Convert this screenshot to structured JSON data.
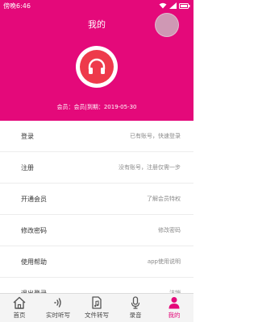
{
  "status_bar": {
    "time": "傍晚6:46"
  },
  "header": {
    "title": "我的",
    "member_info": "会员：会员|到期：2019-05-30"
  },
  "menu": [
    {
      "label": "登录",
      "hint": "已有账号，快速登录"
    },
    {
      "label": "注册",
      "hint": "没有账号，注册仅需一步"
    },
    {
      "label": "开通会员",
      "hint": "了解会员特权"
    },
    {
      "label": "修改密码",
      "hint": "修改密码"
    },
    {
      "label": "使用帮助",
      "hint": "app使用说明"
    },
    {
      "label": "退出登录",
      "hint": "注销"
    }
  ],
  "bottom_nav": [
    {
      "label": "首页",
      "icon": "home-icon"
    },
    {
      "label": "实时听写",
      "icon": "sound-wave-icon"
    },
    {
      "label": "文件转写",
      "icon": "music-file-icon"
    },
    {
      "label": "录音",
      "icon": "microphone-icon"
    },
    {
      "label": "我的",
      "icon": "person-icon"
    }
  ],
  "colors": {
    "accent": "#e4097a",
    "avatar": "#ee3a4b"
  }
}
